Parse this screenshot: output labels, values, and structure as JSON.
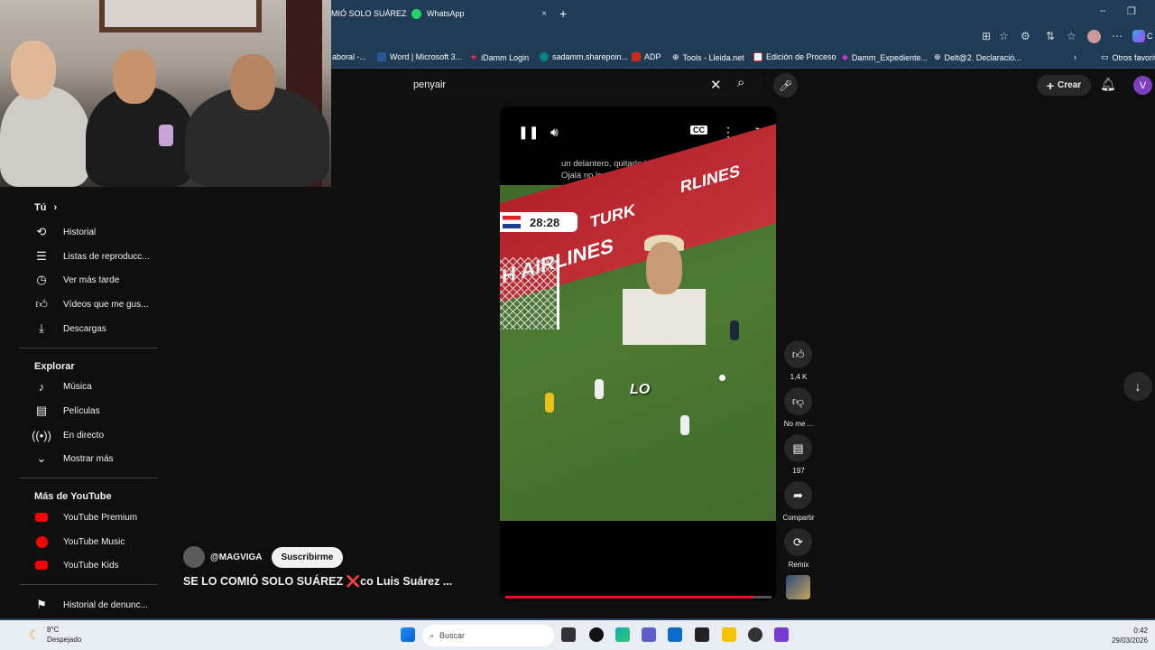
{
  "browser": {
    "tabs": [
      {
        "label": "MIÓ SOLO SUÁREZ"
      },
      {
        "label": "WhatsApp"
      }
    ],
    "bookmarks": [
      {
        "label": "aboral -..."
      },
      {
        "label": "Word | Microsoft 3..."
      },
      {
        "label": "iDamm Login"
      },
      {
        "label": "sadamm.sharepoin..."
      },
      {
        "label": "ADP"
      },
      {
        "label": "Tools - Lleida.net"
      },
      {
        "label": "Edición de Proceso"
      },
      {
        "label": "Damm_Expediente..."
      },
      {
        "label": "Delt@2. Declaració..."
      },
      {
        "label": "Otros favorit"
      }
    ],
    "profile_letter": "C"
  },
  "header": {
    "search_value": "penyair",
    "create_label": "Crear",
    "avatar_letter": "V"
  },
  "sidebar": {
    "you_label": "Tú",
    "you_items": [
      {
        "label": "Historial",
        "icon": "history-icon"
      },
      {
        "label": "Listas de reproducc...",
        "icon": "playlist-icon"
      },
      {
        "label": "Ver más tarde",
        "icon": "clock-icon"
      },
      {
        "label": "Vídeos que me gus...",
        "icon": "like-icon"
      },
      {
        "label": "Descargas",
        "icon": "download-icon"
      }
    ],
    "explore_label": "Explorar",
    "explore_items": [
      {
        "label": "Música",
        "icon": "music-icon"
      },
      {
        "label": "Películas",
        "icon": "film-icon"
      },
      {
        "label": "En directo",
        "icon": "live-icon"
      },
      {
        "label": "Mostrar más",
        "icon": "chevron-down-icon"
      }
    ],
    "more_label": "Más de YouTube",
    "more_items": [
      {
        "label": "YouTube Premium",
        "icon": "youtube-premium-icon"
      },
      {
        "label": "YouTube Music",
        "icon": "youtube-music-icon"
      },
      {
        "label": "YouTube Kids",
        "icon": "youtube-kids-icon"
      }
    ],
    "report_label": "Historial de denunc..."
  },
  "player": {
    "caption_line1": "un delantero, quitarle la confianza.",
    "caption_line2": "Ojalá no lo saquen,",
    "scoreboard_time": "28:28",
    "banner_text_1": "H AIRLINES",
    "banner_text_2": "TURK",
    "banner_text_3": "RLINES",
    "overlay_word": "LO",
    "progress": 0.93
  },
  "actions": {
    "likes": "1,4 K",
    "dislike_label": "No me ...",
    "comments": "197",
    "share_label": "Compartir",
    "remix_label": "Remix"
  },
  "video": {
    "channel": "@MAGVIGA",
    "subscribe_label": "Suscribirme",
    "title": "SE LO COMIÓ SOLO SUÁREZ ❌co Luis Suárez ..."
  },
  "taskbar": {
    "temp": "8°C",
    "weather": "Despejado",
    "search_placeholder": "Buscar",
    "time": "0:42",
    "date": "29/03/2026"
  }
}
